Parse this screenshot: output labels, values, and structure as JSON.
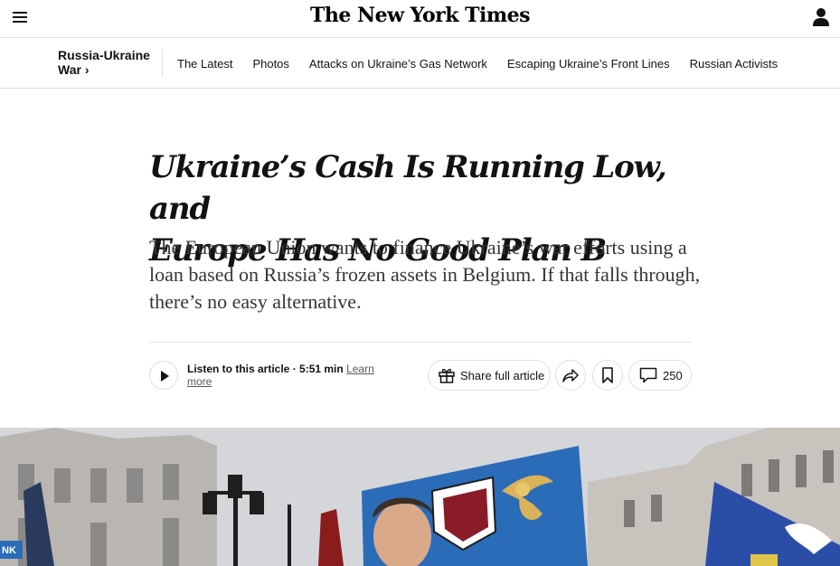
{
  "header": {
    "logo": "The New York Times",
    "menu_icon": "hamburger-menu-icon",
    "account_icon": "user-account-icon"
  },
  "section_nav": {
    "title_line1": "Russia-Ukraine",
    "title_line2": "War ›",
    "links": [
      "The Latest",
      "Photos",
      "Attacks on Ukraine’s Gas Network",
      "Escaping Ukraine’s Front Lines",
      "Russian Activists"
    ]
  },
  "article": {
    "headline_line1": "Ukraine’s Cash Is Running Low, and",
    "headline_line2": "Europe Has No Good Plan B",
    "dek": "The European Union wants to finance Ukraine’s war efforts using a loan based on Russia’s frozen assets in Belgium. If that falls through, there’s no easy alternative."
  },
  "tools": {
    "listen_label": "Listen to this article",
    "listen_duration": " · 5:51 min",
    "learn_more": "Learn more",
    "share_full_label": "Share full article",
    "comment_count": "250",
    "icons": [
      "play-icon",
      "gift-icon",
      "share-arrow-icon",
      "bookmark-icon",
      "comment-bubble-icon"
    ]
  },
  "colors": {
    "text": "#121212",
    "border": "#dfdfdf",
    "dek": "#363636",
    "flag_blue": "#2b6cb8"
  }
}
